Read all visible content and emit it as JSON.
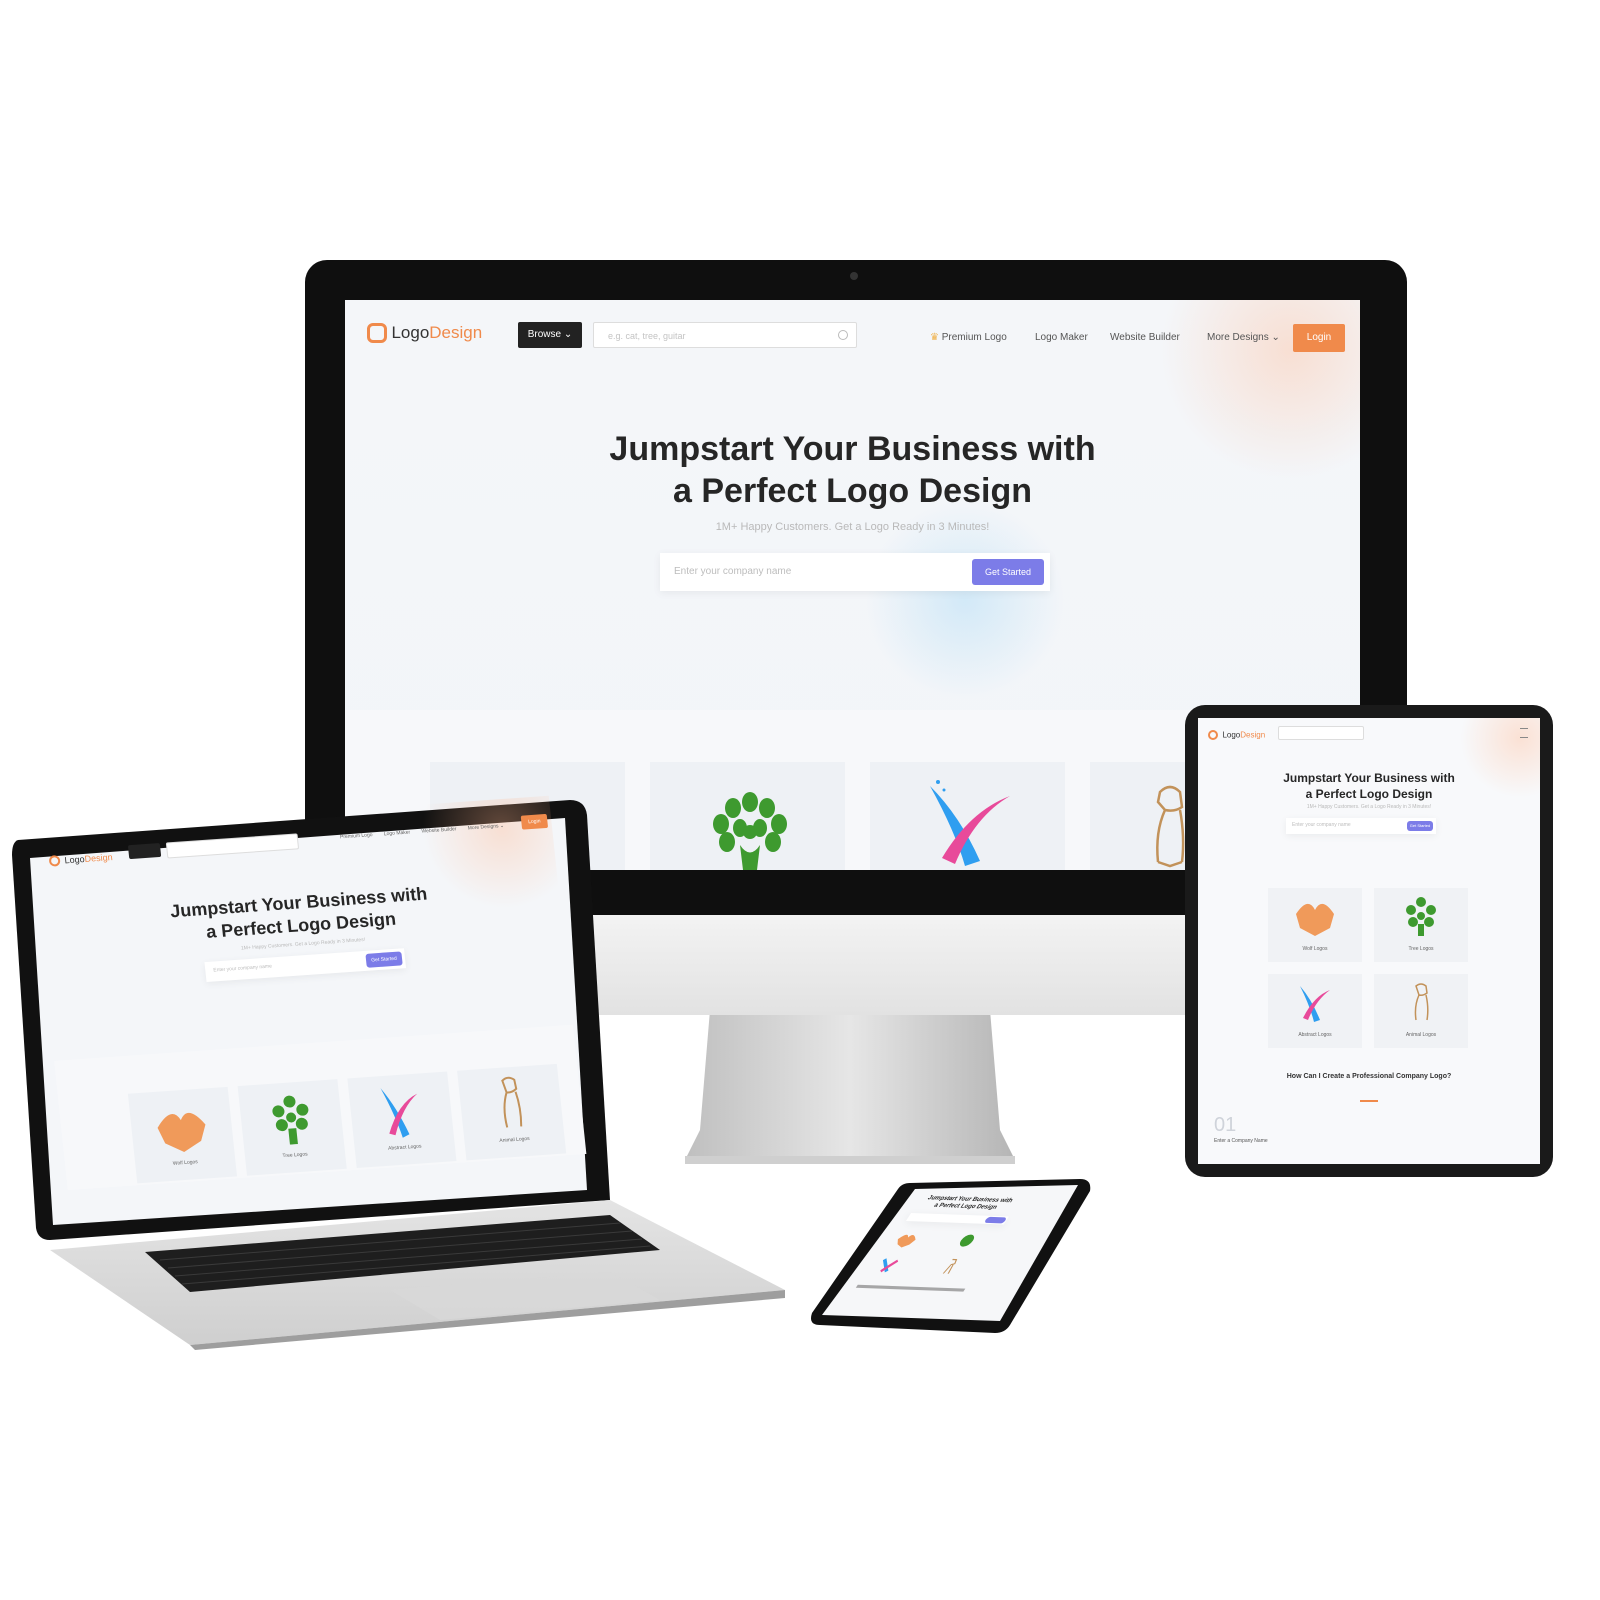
{
  "site": {
    "brand": {
      "name_part1": "Logo",
      "name_part2": "Design"
    },
    "nav": {
      "browse": "Browse ⌄",
      "search_placeholder": "e.g. cat, tree, guitar",
      "links": [
        "Premium Logo",
        "Logo Maker",
        "Website Builder",
        "More Designs ⌄"
      ],
      "login": "Login"
    },
    "hero": {
      "title_line1": "Jumpstart Your Business with",
      "title_line2": "a Perfect Logo Design",
      "subtitle": "1M+ Happy Customers. Get a Logo Ready in 3 Minutes!",
      "input_placeholder": "Enter your company name",
      "cta": "Get Started"
    },
    "logo_categories": [
      "Wolf Logos",
      "Tree Logos",
      "Abstract Logos",
      "Animal Logos"
    ],
    "tablet_section": {
      "heading": "How Can I Create a Professional Company Logo?",
      "step_number": "01",
      "step_title": "Enter a Company Name"
    }
  },
  "colors": {
    "accent_orange": "#f08a4b",
    "cta_purple": "#7c7ce8",
    "tree_green": "#3e9a2f",
    "x_blue": "#2f9ef0",
    "x_pink": "#e84a9a"
  }
}
